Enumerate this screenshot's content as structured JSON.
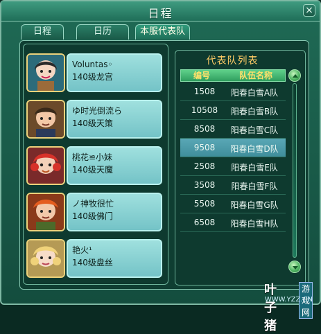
{
  "window": {
    "title": "日程",
    "close_glyph": "×"
  },
  "tabs": [
    {
      "label": "日程",
      "active": false
    },
    {
      "label": "日历",
      "active": false
    },
    {
      "label": "本服代表队",
      "active": true
    }
  ],
  "characters": [
    {
      "name": "Voluntas◦",
      "level": "140级龙宫",
      "avatar": "avatar-girl-dark-hair"
    },
    {
      "name": "ゆ时光倒流ら",
      "level": "140级天策",
      "avatar": "avatar-boy-brown-hair"
    },
    {
      "name": "桃花≌小妹",
      "level": "140级天魔",
      "avatar": "avatar-girl-red-hair"
    },
    {
      "name": "ノ神牧很忙",
      "level": "140级佛门",
      "avatar": "avatar-boy-orange-hair"
    },
    {
      "name": "艳火¹",
      "level": "140级盘丝",
      "avatar": "avatar-girl-blonde-hair"
    }
  ],
  "team_list": {
    "title": "代表队列表",
    "headers": {
      "id": "编号",
      "name": "队伍名称"
    },
    "rows": [
      {
        "id": "1508",
        "name": "阳春白雪A队",
        "selected": false
      },
      {
        "id": "10508",
        "name": "阳春白雪B队",
        "selected": false
      },
      {
        "id": "8508",
        "name": "阳春白雪C队",
        "selected": false
      },
      {
        "id": "9508",
        "name": "阳春白雪D队",
        "selected": true
      },
      {
        "id": "2508",
        "name": "阳春白雪E队",
        "selected": false
      },
      {
        "id": "3508",
        "name": "阳春白雪F队",
        "selected": false
      },
      {
        "id": "5508",
        "name": "阳春白雪G队",
        "selected": false
      },
      {
        "id": "6508",
        "name": "阳春白雪H队",
        "selected": false
      }
    ]
  },
  "watermark": {
    "brand": "叶子猪",
    "tag": "游戏网",
    "url": "WWW.YZZ.CN"
  },
  "colors": {
    "accent": "#ffcc66",
    "header": "#ffe16a",
    "selected_row": "#4c9aa8"
  }
}
